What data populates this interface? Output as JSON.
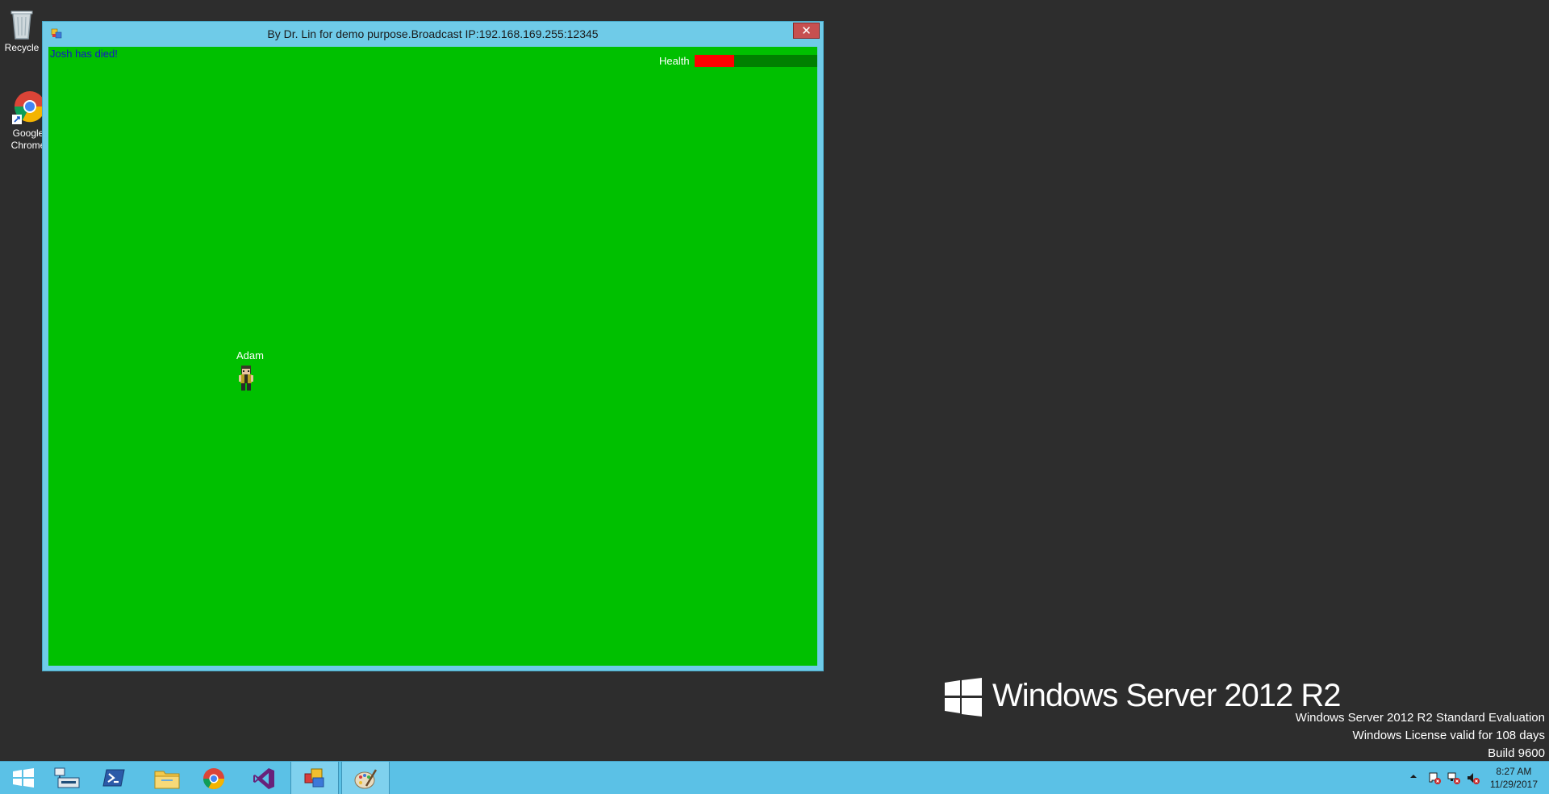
{
  "desktop": {
    "icons": [
      {
        "label": "Recycle"
      },
      {
        "label": "Google Chrome"
      }
    ]
  },
  "window": {
    "title": "By Dr. Lin for demo purpose.Broadcast IP:192.168.169.255:12345",
    "close_label": "✕"
  },
  "game": {
    "message": "Josh has died!",
    "health_label": "Health",
    "health_fraction": 0.32,
    "player_name": "Adam",
    "colors": {
      "field": "#00c000",
      "health_fill": "#ff0000",
      "health_empty": "#008000",
      "message": "#1414c8"
    }
  },
  "branding": {
    "logo_text": "Windows Server 2012 R2",
    "watermark": [
      "Windows Server 2012 R2 Standard Evaluation",
      "Windows License valid for 108 days",
      "Build 9600"
    ]
  },
  "taskbar": {
    "buttons": [
      "start-icon",
      "server-manager-icon",
      "powershell-icon",
      "file-explorer-icon",
      "chrome-icon",
      "visual-studio-icon",
      "game-app-icon",
      "paint-icon"
    ],
    "clock_time": "8:27 AM",
    "clock_date": "11/29/2017"
  }
}
